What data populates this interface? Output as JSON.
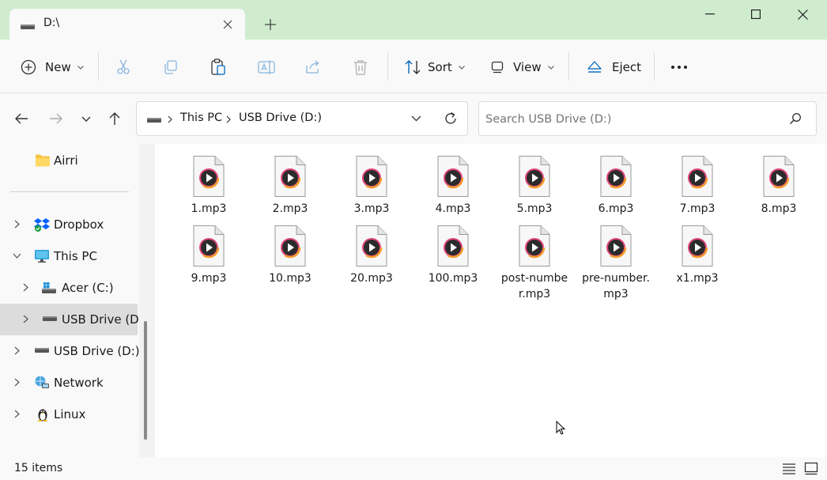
{
  "tab": {
    "title": "D:\\"
  },
  "toolbar": {
    "new_label": "New",
    "sort_label": "Sort",
    "view_label": "View",
    "eject_label": "Eject"
  },
  "address": {
    "crumbs": [
      "This PC",
      "USB Drive (D:)"
    ]
  },
  "search": {
    "placeholder": "Search USB Drive (D:)"
  },
  "sidebar": {
    "items": [
      {
        "label": "Airri"
      },
      {
        "label": "Dropbox"
      },
      {
        "label": "This PC"
      },
      {
        "label": "Acer (C:)"
      },
      {
        "label": "USB Drive (D:)"
      },
      {
        "label": "USB Drive (D:)"
      },
      {
        "label": "Network"
      },
      {
        "label": "Linux"
      }
    ]
  },
  "files": [
    {
      "name": "1.mp3"
    },
    {
      "name": "2.mp3"
    },
    {
      "name": "3.mp3"
    },
    {
      "name": "4.mp3"
    },
    {
      "name": "5.mp3"
    },
    {
      "name": "6.mp3"
    },
    {
      "name": "7.mp3"
    },
    {
      "name": "8.mp3"
    },
    {
      "name": "9.mp3"
    },
    {
      "name": "10.mp3"
    },
    {
      "name": "20.mp3"
    },
    {
      "name": "100.mp3"
    },
    {
      "name": "post-number.mp3"
    },
    {
      "name": "pre-number.mp3"
    },
    {
      "name": "x1.mp3"
    }
  ],
  "status": {
    "count": "15 items"
  },
  "colors": {
    "accent": "#0067c0",
    "tabbar": "#cfeccf",
    "selected": "#dcdcdc"
  }
}
